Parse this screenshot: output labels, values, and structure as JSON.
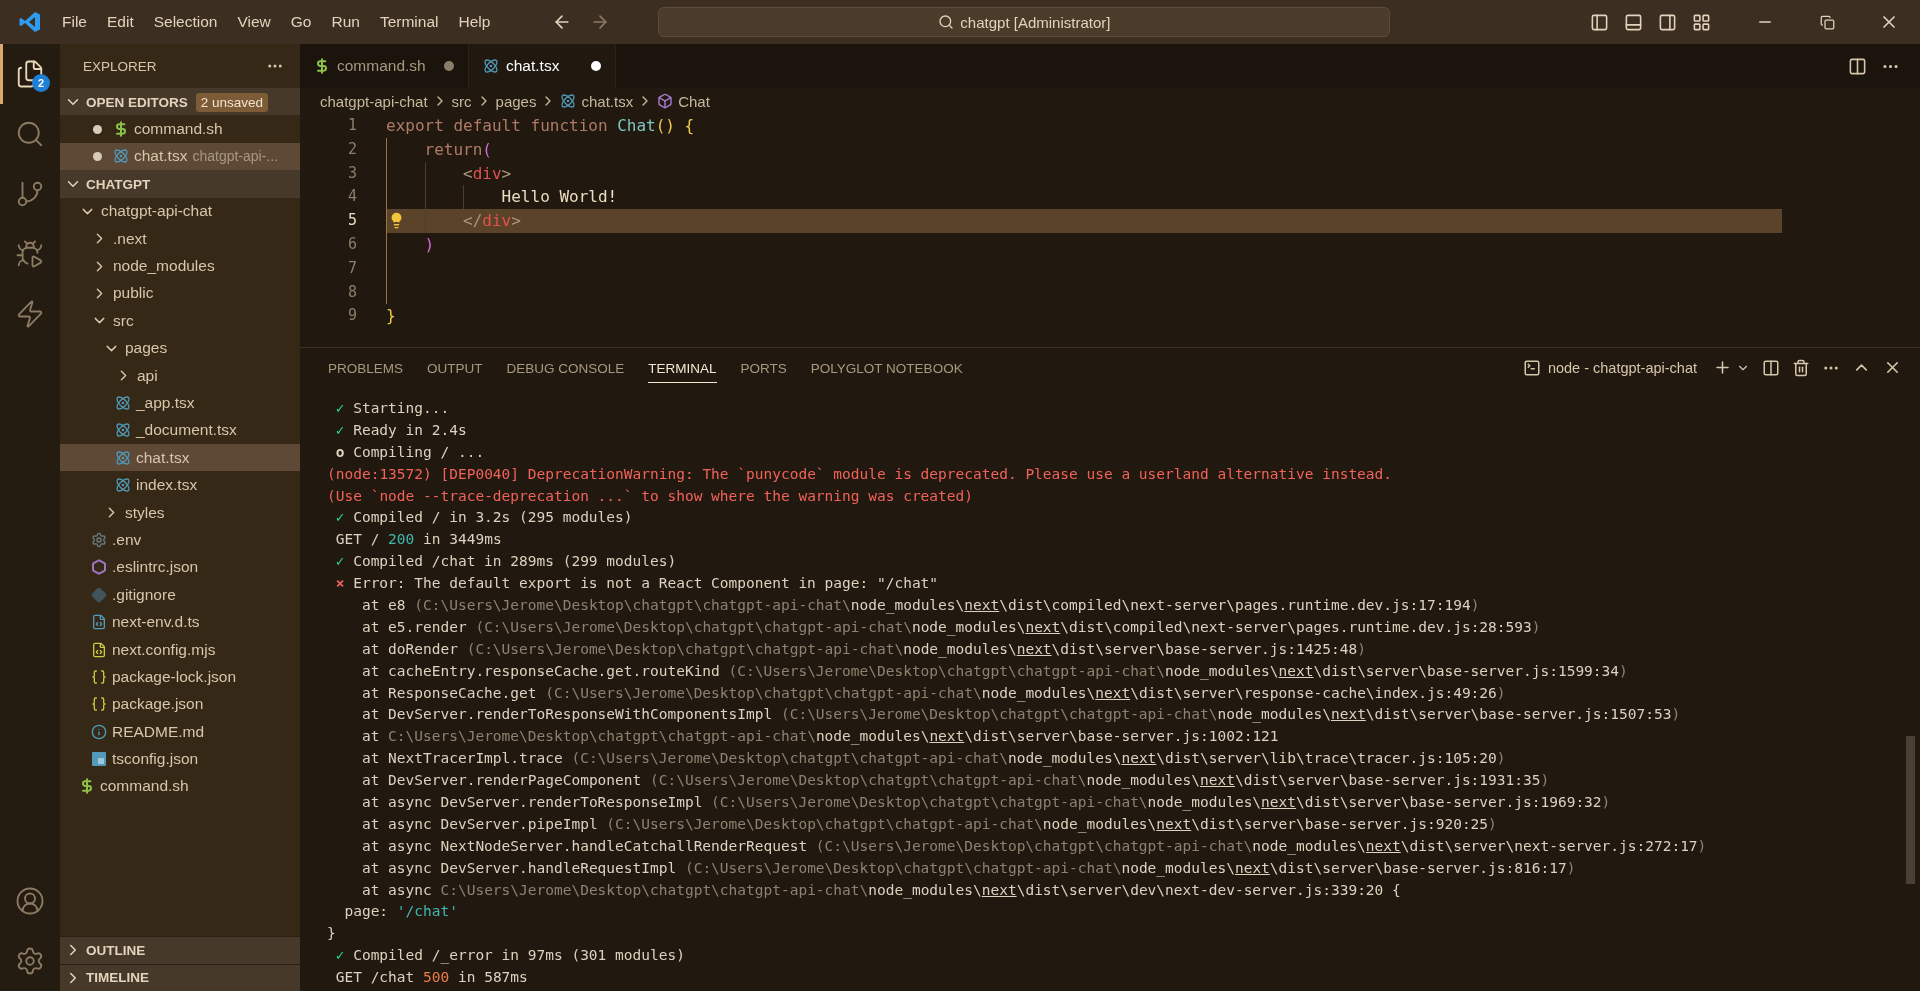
{
  "title_bar": {
    "menu": [
      "File",
      "Edit",
      "Selection",
      "View",
      "Go",
      "Run",
      "Terminal",
      "Help"
    ],
    "nav": [
      {
        "kind": "back",
        "disabled": false
      },
      {
        "kind": "forward",
        "disabled": true
      }
    ],
    "command_center": "chatgpt [Administrator]"
  },
  "activity_bar": {
    "items": [
      {
        "kind": "explorer",
        "selected": true,
        "badge": "2"
      },
      {
        "kind": "search",
        "selected": false
      },
      {
        "kind": "source-control",
        "selected": false
      },
      {
        "kind": "run-debug",
        "selected": false
      },
      {
        "kind": "polyglot",
        "selected": false
      }
    ],
    "bottom": [
      {
        "kind": "account"
      },
      {
        "kind": "settings"
      }
    ]
  },
  "sidebar": {
    "title": "EXPLORER",
    "open_editors": {
      "label": "OPEN EDITORS",
      "expanded": true,
      "badge": "2 unsaved",
      "items": [
        {
          "name": "command.sh",
          "kind": "sh",
          "dirty": true,
          "selected": false
        },
        {
          "name": "chat.tsx",
          "kind": "tsx",
          "description": "chatgpt-api-...",
          "dirty": true,
          "selected": true
        }
      ]
    },
    "workspace": {
      "label": "CHATGPT",
      "expanded": true,
      "tree": [
        {
          "name": "chatgpt-api-chat",
          "kind": "folder",
          "expanded": true,
          "selected": false,
          "children": [
            {
              "name": ".next",
              "kind": "folder",
              "expanded": false,
              "selected": false
            },
            {
              "name": "node_modules",
              "kind": "folder",
              "expanded": false,
              "selected": false
            },
            {
              "name": "public",
              "kind": "folder",
              "expanded": false,
              "selected": false
            },
            {
              "name": "src",
              "kind": "folder",
              "expanded": true,
              "selected": false,
              "children": [
                {
                  "name": "pages",
                  "kind": "folder",
                  "expanded": true,
                  "selected": false,
                  "children": [
                    {
                      "name": "api",
                      "kind": "folder",
                      "expanded": false,
                      "selected": false
                    },
                    {
                      "name": "_app.tsx",
                      "kind": "tsx",
                      "selected": false
                    },
                    {
                      "name": "_document.tsx",
                      "kind": "tsx",
                      "selected": false
                    },
                    {
                      "name": "chat.tsx",
                      "kind": "tsx",
                      "selected": true
                    },
                    {
                      "name": "index.tsx",
                      "kind": "tsx",
                      "selected": false
                    }
                  ]
                },
                {
                  "name": "styles",
                  "kind": "folder",
                  "expanded": false,
                  "selected": false
                }
              ]
            },
            {
              "name": ".env",
              "kind": "env",
              "selected": false
            },
            {
              "name": ".eslintrc.json",
              "kind": "eslint",
              "selected": false
            },
            {
              "name": ".gitignore",
              "kind": "gitignore",
              "selected": false
            },
            {
              "name": "next-env.d.ts",
              "kind": "ts",
              "selected": false
            },
            {
              "name": "next.config.mjs",
              "kind": "mjs",
              "selected": false
            },
            {
              "name": "package-lock.json",
              "kind": "json",
              "selected": false
            },
            {
              "name": "package.json",
              "kind": "json",
              "selected": false
            },
            {
              "name": "README.md",
              "kind": "md",
              "selected": false
            },
            {
              "name": "tsconfig.json",
              "kind": "tsconfig",
              "selected": false
            }
          ]
        },
        {
          "name": "command.sh",
          "kind": "sh",
          "selected": false
        }
      ]
    },
    "sections": [
      {
        "label": "OUTLINE",
        "expanded": false
      },
      {
        "label": "TIMELINE",
        "expanded": false
      }
    ]
  },
  "editor": {
    "tabs": [
      {
        "label": "command.sh",
        "kind": "sh",
        "selected": false,
        "dirty": true
      },
      {
        "label": "chat.tsx",
        "kind": "tsx",
        "selected": true,
        "dirty": true
      }
    ],
    "breadcrumb": [
      {
        "label": "chatgpt-api-chat",
        "kind": "folder"
      },
      {
        "label": "src",
        "kind": "folder"
      },
      {
        "label": "pages",
        "kind": "folder"
      },
      {
        "label": "chat.tsx",
        "kind": "tsx"
      },
      {
        "label": "Chat",
        "kind": "component"
      }
    ],
    "lines": [
      {
        "number": "1",
        "current": false,
        "tokens": [
          {
            "kind": "keyword",
            "text": "export default function "
          },
          {
            "kind": "function",
            "text": "Chat"
          },
          {
            "kind": "bracket",
            "text": "() {"
          }
        ]
      },
      {
        "number": "2",
        "current": false,
        "tokens": [
          {
            "kind": "keyword",
            "text": "    return"
          },
          {
            "kind": "paren",
            "text": "("
          }
        ]
      },
      {
        "number": "3",
        "current": false,
        "tokens": [
          {
            "kind": "punct",
            "text": "        <"
          },
          {
            "kind": "tag",
            "text": "div"
          },
          {
            "kind": "punct",
            "text": ">"
          }
        ]
      },
      {
        "number": "4",
        "current": false,
        "tokens": [
          {
            "kind": "text",
            "text": "            Hello World!"
          }
        ]
      },
      {
        "number": "5",
        "current": true,
        "tokens": [
          {
            "kind": "punct",
            "text": "        </"
          },
          {
            "kind": "tag",
            "text": "div"
          },
          {
            "kind": "punct",
            "text": ">"
          }
        ]
      },
      {
        "number": "6",
        "current": false,
        "tokens": [
          {
            "kind": "paren",
            "text": "    )"
          }
        ]
      },
      {
        "number": "7",
        "current": false
      },
      {
        "number": "8",
        "current": false
      },
      {
        "number": "9",
        "current": false,
        "tokens": [
          {
            "kind": "bracket",
            "text": "}"
          }
        ]
      }
    ]
  },
  "panel": {
    "tabs": [
      {
        "label": "PROBLEMS",
        "selected": false
      },
      {
        "label": "OUTPUT",
        "selected": false
      },
      {
        "label": "DEBUG CONSOLE",
        "selected": false
      },
      {
        "label": "TERMINAL",
        "selected": true
      },
      {
        "label": "PORTS",
        "selected": false
      },
      {
        "label": "POLYGLOT NOTEBOOK",
        "selected": false
      }
    ],
    "terminal_name": "node - chatgpt-api-chat",
    "lines": [
      {
        "kind": "log",
        "segments": [
          {
            "kind": "success-mark",
            "text": "✓"
          },
          {
            "kind": "plain",
            "text": "Starting..."
          }
        ]
      },
      {
        "kind": "log",
        "segments": [
          {
            "kind": "success-mark",
            "text": "✓"
          },
          {
            "kind": "plain",
            "text": "Ready in 2.4s"
          }
        ]
      },
      {
        "kind": "log",
        "segments": [
          {
            "kind": "pending-mark",
            "text": "o"
          },
          {
            "kind": "plain",
            "text": "Compiling / ..."
          }
        ]
      },
      {
        "kind": "plain",
        "segments": [
          {
            "kind": "warn",
            "text": "(node:13572) [DEP0040] DeprecationWarning: The `punycode` module is deprecated. Please use a userland alternative instead."
          }
        ]
      },
      {
        "kind": "plain",
        "segments": [
          {
            "kind": "warn",
            "text": "(Use `node --trace-deprecation ...` to show where the warning was created)"
          }
        ]
      },
      {
        "kind": "log",
        "segments": [
          {
            "kind": "success-mark",
            "text": "✓"
          },
          {
            "kind": "plain",
            "text": "Compiled / in 3.2s (295 modules)"
          }
        ]
      },
      {
        "kind": "log",
        "segments": [
          {
            "kind": "plain",
            "text": "GET / "
          },
          {
            "kind": "ok",
            "text": "200"
          },
          {
            "kind": "plain",
            "text": " in 3449ms"
          }
        ]
      },
      {
        "kind": "log",
        "segments": [
          {
            "kind": "success-mark",
            "text": "✓"
          },
          {
            "kind": "plain",
            "text": "Compiled /chat in 289ms (299 modules)"
          }
        ]
      },
      {
        "kind": "log",
        "segments": [
          {
            "kind": "error-mark",
            "text": "×"
          },
          {
            "kind": "plain",
            "text": "Error: The default export is not a React Component in page: \"/chat\""
          }
        ]
      },
      {
        "kind": "stack",
        "segments": [
          {
            "kind": "plain",
            "text": "at e8 "
          },
          {
            "kind": "dim",
            "text": "(C:\\Users\\Jerome\\Desktop\\chatgpt\\chatgpt-api-chat\\"
          },
          {
            "kind": "plain",
            "text": "node_modules\\"
          },
          {
            "kind": "link",
            "text": "next"
          },
          {
            "kind": "plain",
            "text": "\\dist\\compiled\\next-server\\pages.runtime.dev.js:17:194"
          },
          {
            "kind": "dim",
            "text": ")"
          }
        ]
      },
      {
        "kind": "stack",
        "segments": [
          {
            "kind": "plain",
            "text": "at e5.render "
          },
          {
            "kind": "dim",
            "text": "(C:\\Users\\Jerome\\Desktop\\chatgpt\\chatgpt-api-chat\\"
          },
          {
            "kind": "plain",
            "text": "node_modules\\"
          },
          {
            "kind": "link",
            "text": "next"
          },
          {
            "kind": "plain",
            "text": "\\dist\\compiled\\next-server\\pages.runtime.dev.js:28:593"
          },
          {
            "kind": "dim",
            "text": ")"
          }
        ]
      },
      {
        "kind": "stack",
        "segments": [
          {
            "kind": "plain",
            "text": "at doRender "
          },
          {
            "kind": "dim",
            "text": "(C:\\Users\\Jerome\\Desktop\\chatgpt\\chatgpt-api-chat\\"
          },
          {
            "kind": "plain",
            "text": "node_modules\\"
          },
          {
            "kind": "link",
            "text": "next"
          },
          {
            "kind": "plain",
            "text": "\\dist\\server\\base-server.js:1425:48"
          },
          {
            "kind": "dim",
            "text": ")"
          }
        ]
      },
      {
        "kind": "stack",
        "segments": [
          {
            "kind": "plain",
            "text": "at cacheEntry.responseCache.get.routeKind "
          },
          {
            "kind": "dim",
            "text": "(C:\\Users\\Jerome\\Desktop\\chatgpt\\chatgpt-api-chat\\"
          },
          {
            "kind": "plain",
            "text": "node_modules\\"
          },
          {
            "kind": "link",
            "text": "next"
          },
          {
            "kind": "plain",
            "text": "\\dist\\server\\base-server.js:1599:34"
          },
          {
            "kind": "dim",
            "text": ")"
          }
        ]
      },
      {
        "kind": "stack",
        "segments": [
          {
            "kind": "plain",
            "text": "at ResponseCache.get "
          },
          {
            "kind": "dim",
            "text": "(C:\\Users\\Jerome\\Desktop\\chatgpt\\chatgpt-api-chat\\"
          },
          {
            "kind": "plain",
            "text": "node_modules\\"
          },
          {
            "kind": "link",
            "text": "next"
          },
          {
            "kind": "plain",
            "text": "\\dist\\server\\response-cache\\index.js:49:26"
          },
          {
            "kind": "dim",
            "text": ")"
          }
        ]
      },
      {
        "kind": "stack",
        "segments": [
          {
            "kind": "plain",
            "text": "at DevServer.renderToResponseWithComponentsImpl "
          },
          {
            "kind": "dim",
            "text": "(C:\\Users\\Jerome\\Desktop\\chatgpt\\chatgpt-api-chat\\"
          },
          {
            "kind": "plain",
            "text": "node_modules\\"
          },
          {
            "kind": "link",
            "text": "next"
          },
          {
            "kind": "plain",
            "text": "\\dist\\server\\base-server.js:1507:53"
          },
          {
            "kind": "dim",
            "text": ")"
          }
        ]
      },
      {
        "kind": "stack",
        "segments": [
          {
            "kind": "plain",
            "text": "at "
          },
          {
            "kind": "dim",
            "text": "C:\\Users\\Jerome\\Desktop\\chatgpt\\chatgpt-api-chat\\"
          },
          {
            "kind": "plain",
            "text": "node_modules\\"
          },
          {
            "kind": "link",
            "text": "next"
          },
          {
            "kind": "plain",
            "text": "\\dist\\server\\base-server.js:1002:121"
          }
        ]
      },
      {
        "kind": "stack",
        "segments": [
          {
            "kind": "plain",
            "text": "at NextTracerImpl.trace "
          },
          {
            "kind": "dim",
            "text": "(C:\\Users\\Jerome\\Desktop\\chatgpt\\chatgpt-api-chat\\"
          },
          {
            "kind": "plain",
            "text": "node_modules\\"
          },
          {
            "kind": "link",
            "text": "next"
          },
          {
            "kind": "plain",
            "text": "\\dist\\server\\lib\\trace\\tracer.js:105:20"
          },
          {
            "kind": "dim",
            "text": ")"
          }
        ]
      },
      {
        "kind": "stack",
        "segments": [
          {
            "kind": "plain",
            "text": "at DevServer.renderPageComponent "
          },
          {
            "kind": "dim",
            "text": "(C:\\Users\\Jerome\\Desktop\\chatgpt\\chatgpt-api-chat\\"
          },
          {
            "kind": "plain",
            "text": "node_modules\\"
          },
          {
            "kind": "link",
            "text": "next"
          },
          {
            "kind": "plain",
            "text": "\\dist\\server\\base-server.js:1931:35"
          },
          {
            "kind": "dim",
            "text": ")"
          }
        ]
      },
      {
        "kind": "stack",
        "segments": [
          {
            "kind": "plain",
            "text": "at async DevServer.renderToResponseImpl "
          },
          {
            "kind": "dim",
            "text": "(C:\\Users\\Jerome\\Desktop\\chatgpt\\chatgpt-api-chat\\"
          },
          {
            "kind": "plain",
            "text": "node_modules\\"
          },
          {
            "kind": "link",
            "text": "next"
          },
          {
            "kind": "plain",
            "text": "\\dist\\server\\base-server.js:1969:32"
          },
          {
            "kind": "dim",
            "text": ")"
          }
        ]
      },
      {
        "kind": "stack",
        "segments": [
          {
            "kind": "plain",
            "text": "at async DevServer.pipeImpl "
          },
          {
            "kind": "dim",
            "text": "(C:\\Users\\Jerome\\Desktop\\chatgpt\\chatgpt-api-chat\\"
          },
          {
            "kind": "plain",
            "text": "node_modules\\"
          },
          {
            "kind": "link",
            "text": "next"
          },
          {
            "kind": "plain",
            "text": "\\dist\\server\\base-server.js:920:25"
          },
          {
            "kind": "dim",
            "text": ")"
          }
        ]
      },
      {
        "kind": "stack",
        "segments": [
          {
            "kind": "plain",
            "text": "at async NextNodeServer.handleCatchallRenderRequest "
          },
          {
            "kind": "dim",
            "text": "(C:\\Users\\Jerome\\Desktop\\chatgpt\\chatgpt-api-chat\\"
          },
          {
            "kind": "plain",
            "text": "node_modules\\"
          },
          {
            "kind": "link",
            "text": "next"
          },
          {
            "kind": "plain",
            "text": "\\dist\\server\\next-server.js:272:17"
          },
          {
            "kind": "dim",
            "text": ")"
          }
        ]
      },
      {
        "kind": "stack",
        "segments": [
          {
            "kind": "plain",
            "text": "at async DevServer.handleRequestImpl "
          },
          {
            "kind": "dim",
            "text": "(C:\\Users\\Jerome\\Desktop\\chatgpt\\chatgpt-api-chat\\"
          },
          {
            "kind": "plain",
            "text": "node_modules\\"
          },
          {
            "kind": "link",
            "text": "next"
          },
          {
            "kind": "plain",
            "text": "\\dist\\server\\base-server.js:816:17"
          },
          {
            "kind": "dim",
            "text": ")"
          }
        ]
      },
      {
        "kind": "stack",
        "segments": [
          {
            "kind": "plain",
            "text": "at async "
          },
          {
            "kind": "dim",
            "text": "C:\\Users\\Jerome\\Desktop\\chatgpt\\chatgpt-api-chat\\"
          },
          {
            "kind": "plain",
            "text": "node_modules\\"
          },
          {
            "kind": "link",
            "text": "next"
          },
          {
            "kind": "plain",
            "text": "\\dist\\server\\dev\\next-dev-server.js:339:20 {"
          }
        ]
      },
      {
        "kind": "prop",
        "segments": [
          {
            "kind": "plain",
            "text": "page: "
          },
          {
            "kind": "string",
            "text": "'/chat'"
          }
        ]
      },
      {
        "kind": "plain",
        "segments": [
          {
            "kind": "plain",
            "text": "}"
          }
        ]
      },
      {
        "kind": "log",
        "segments": [
          {
            "kind": "success-mark",
            "text": "✓"
          },
          {
            "kind": "plain",
            "text": "Compiled /_error in 97ms (301 modules)"
          }
        ]
      },
      {
        "kind": "log",
        "segments": [
          {
            "kind": "plain",
            "text": "GET /chat "
          },
          {
            "kind": "bad",
            "text": "500"
          },
          {
            "kind": "plain",
            "text": " in 587ms"
          }
        ]
      }
    ]
  }
}
